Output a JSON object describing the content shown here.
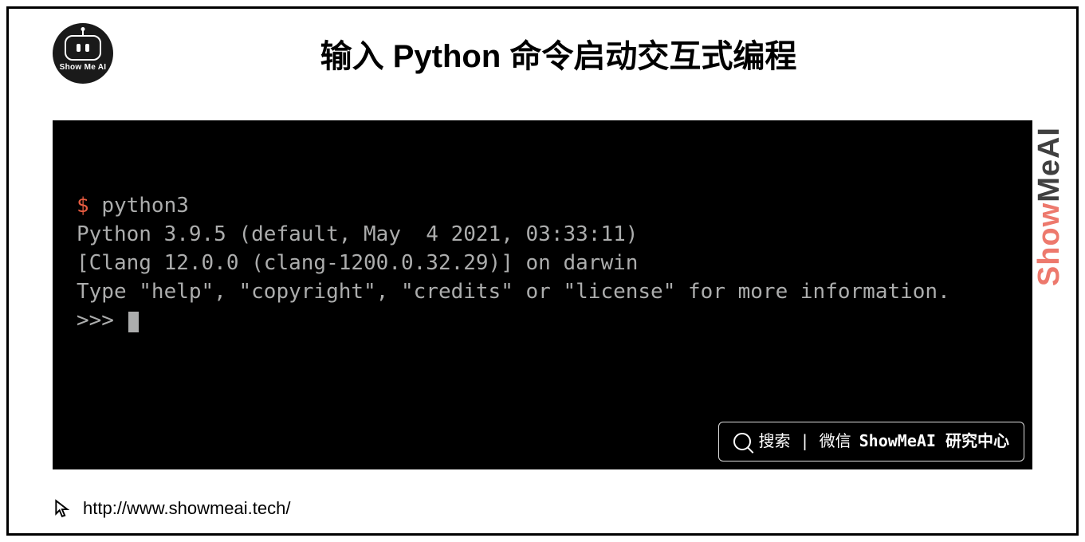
{
  "logo": {
    "text": "Show Me AI"
  },
  "title": "输入 Python 命令启动交互式编程",
  "terminal": {
    "prompt_symbol": "$",
    "command": "python3",
    "line1": "Python 3.9.5 (default, May  4 2021, 03:33:11)",
    "line2": "[Clang 12.0.0 (clang-1200.0.32.29)] on darwin",
    "line3": "Type \"help\", \"copyright\", \"credits\" or \"license\" for more information.",
    "repl_prompt": ">>> "
  },
  "watermark": {
    "show": "Show",
    "meai": "MeAI"
  },
  "search_badge": {
    "label": "搜索 | 微信",
    "brand": "ShowMeAI 研究中心"
  },
  "footer": {
    "url": "http://www.showmeai.tech/"
  }
}
